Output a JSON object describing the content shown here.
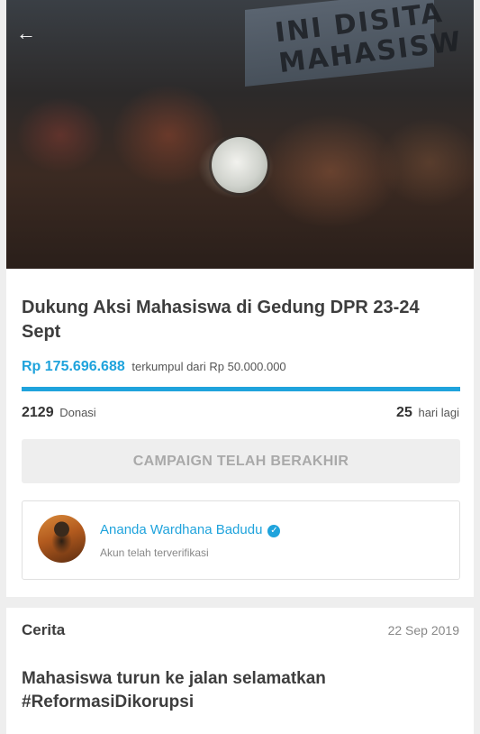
{
  "hero": {
    "image_alt": "Foto aksi mahasiswa",
    "banner_text": "INI DISITA\nMAHASISW"
  },
  "campaign": {
    "title": "Dukung Aksi Mahasiswa di Gedung DPR 23-24 Sept",
    "amount_collected": "Rp 175.696.688",
    "target_text": "terkumpul dari Rp 50.000.000",
    "progress_percent": 100,
    "donation_count": "2129",
    "donation_label": "Donasi",
    "days_count": "25",
    "days_label": "hari lagi",
    "cta_label": "CAMPAIGN TELAH BERAKHIR"
  },
  "organizer": {
    "name": "Ananda Wardhana Badudu",
    "status": "Akun telah terverifikasi"
  },
  "story": {
    "heading": "Cerita",
    "date": "22 Sep 2019",
    "title": "Mahasiswa turun ke jalan selamatkan #ReformasiDikorupsi"
  },
  "colors": {
    "accent": "#1fa3dc",
    "text": "#3d3d3d",
    "page_bg": "#eeeeee"
  },
  "icons": {
    "back": "arrow-left-icon",
    "verified": "verified-check-icon"
  }
}
